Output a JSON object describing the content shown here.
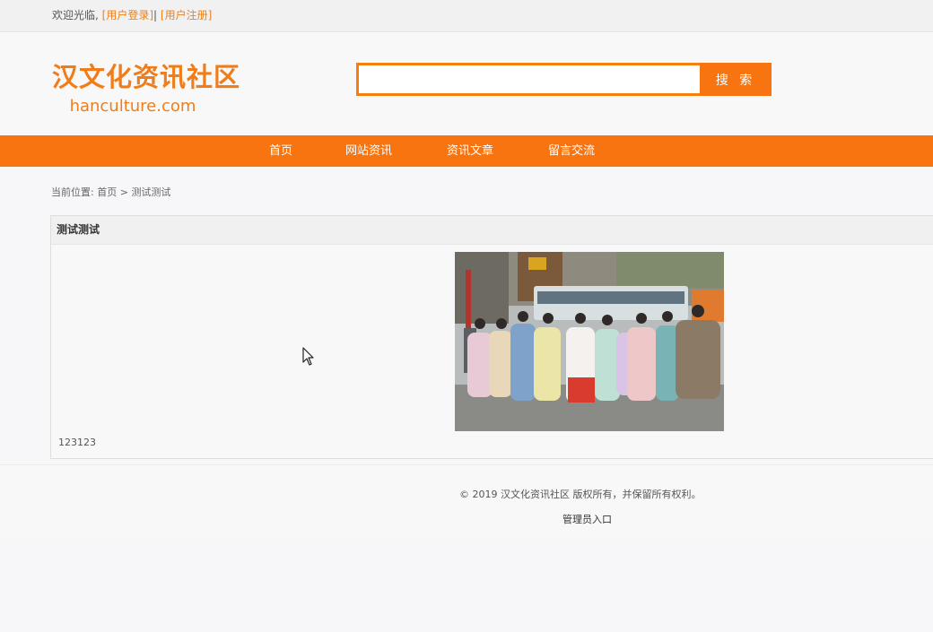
{
  "topbar": {
    "welcome": "欢迎光临,",
    "login": "[用户登录]",
    "sep": "|",
    "register": "[用户注册]"
  },
  "logo": {
    "title": "汉文化资讯社区",
    "domain": "hanculture.com"
  },
  "search": {
    "value": "",
    "button": "搜 索"
  },
  "nav": [
    {
      "label": "首页"
    },
    {
      "label": "网站资讯"
    },
    {
      "label": "资讯文章"
    },
    {
      "label": "留言交流"
    }
  ],
  "breadcrumb": {
    "prefix": "当前位置:",
    "home": "首页",
    "sep": ">",
    "current": "测试测试"
  },
  "article": {
    "title": "测试测试",
    "content": "123123",
    "photo_alt": "hanfu-group-photo"
  },
  "footer": {
    "copyright": "© 2019 汉文化资讯社区 版权所有，并保留所有权利。",
    "admin": "管理员入口"
  },
  "colors": {
    "accent": "#f77410",
    "logo": "#f07d1a"
  }
}
